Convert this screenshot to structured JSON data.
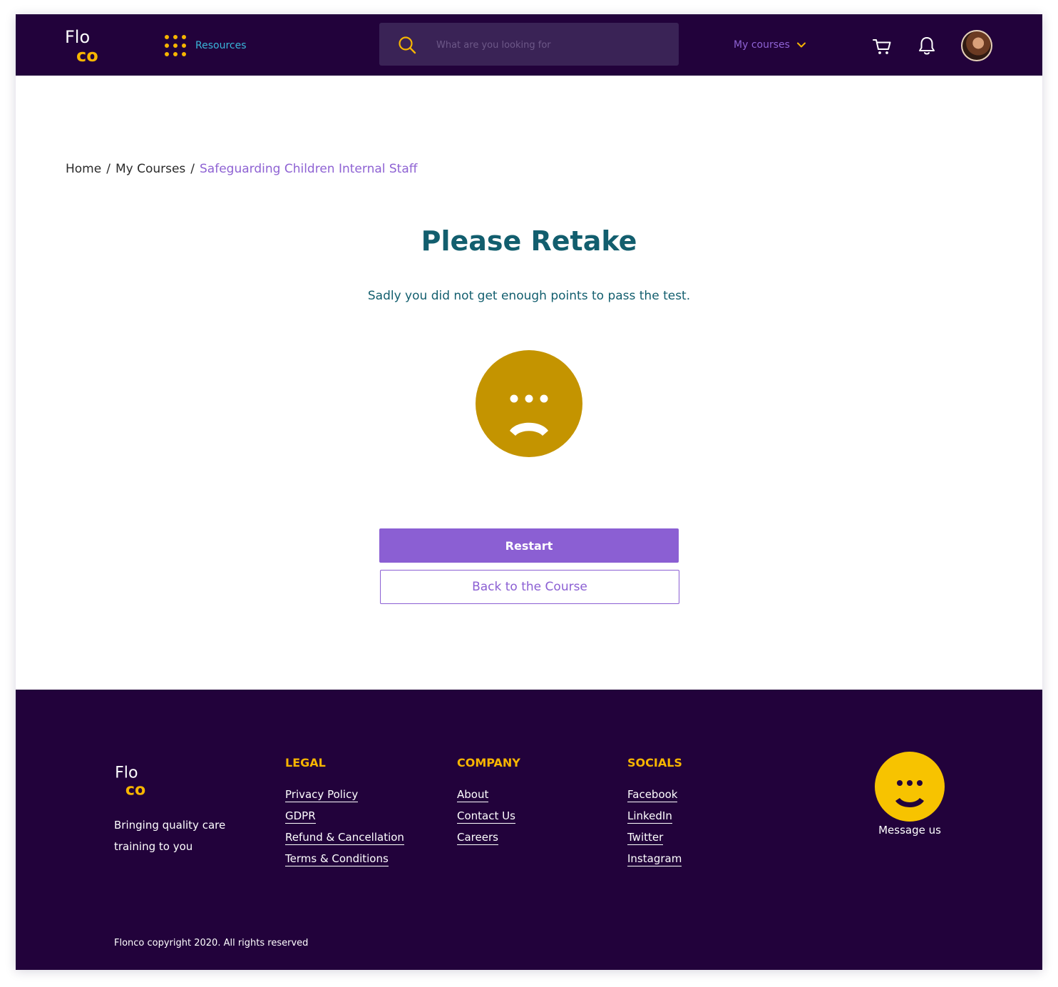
{
  "header": {
    "logo_top": "Flo",
    "logo_bottom": "co",
    "resources_label": "Resources",
    "search_placeholder": "What are you looking for",
    "my_courses_label": "My courses"
  },
  "breadcrumb": {
    "home": "Home",
    "separator": "/",
    "my_courses": "My Courses",
    "current": "Safeguarding Children Internal Staff"
  },
  "result": {
    "title": "Please Retake",
    "message": "Sadly you did not get enough points to pass the test.",
    "restart_label": "Restart",
    "back_label": "Back to the Course"
  },
  "footer": {
    "tagline": "Bringing quality care training to you",
    "legal": {
      "heading": "LEGAL",
      "links": [
        "Privacy Policy",
        "GDPR",
        "Refund & Cancellation",
        "Terms & Conditions"
      ]
    },
    "company": {
      "heading": "COMPANY",
      "links": [
        "About",
        "Contact Us",
        "Careers"
      ]
    },
    "socials": {
      "heading": "SOCIALS",
      "links": [
        "Facebook",
        "LinkedIn",
        "Twitter",
        "Instagram"
      ]
    },
    "message_label": "Message us",
    "copyright": "Flonco copyright 2020. All rights reserved"
  },
  "colors": {
    "brand_dark": "#22023b",
    "accent_yellow": "#f7b500",
    "accent_purple": "#8b5fd3",
    "title_teal": "#125e6e",
    "sad_face": "#c49400"
  },
  "icons": [
    "logo",
    "grid-dots-icon",
    "search-icon",
    "chevron-down-icon",
    "cart-icon",
    "bell-icon",
    "avatar",
    "sad-face-icon",
    "happy-face-icon"
  ]
}
